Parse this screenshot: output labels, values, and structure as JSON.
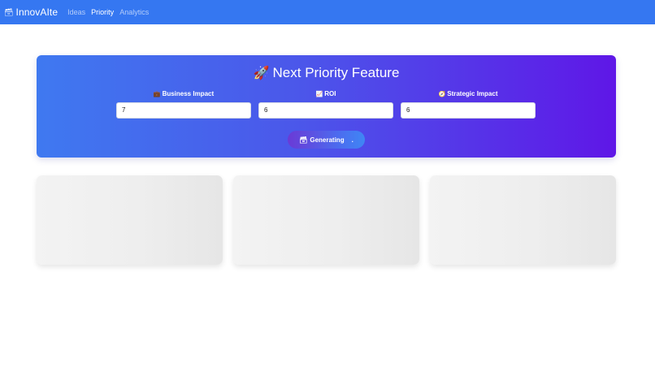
{
  "navbar": {
    "brand_icon": "🗃",
    "brand": "InnovAIte",
    "links": [
      "Ideas",
      "Priority",
      "Analytics"
    ],
    "active": "Priority",
    "background": "#3577f1"
  },
  "hero": {
    "title_icon": "🚀",
    "title": "Next Priority Feature",
    "fields": [
      {
        "icon": "💼",
        "label": "Business Impact",
        "value": "7"
      },
      {
        "icon": "📈",
        "label": "ROI",
        "value": "6"
      },
      {
        "icon": "🧭",
        "label": "Strategic Impact",
        "value": "6"
      }
    ],
    "button": {
      "icon": "🗃",
      "label": "Generating",
      "suffix": "."
    }
  },
  "placeholders": {
    "count": 3,
    "state": "loading"
  }
}
